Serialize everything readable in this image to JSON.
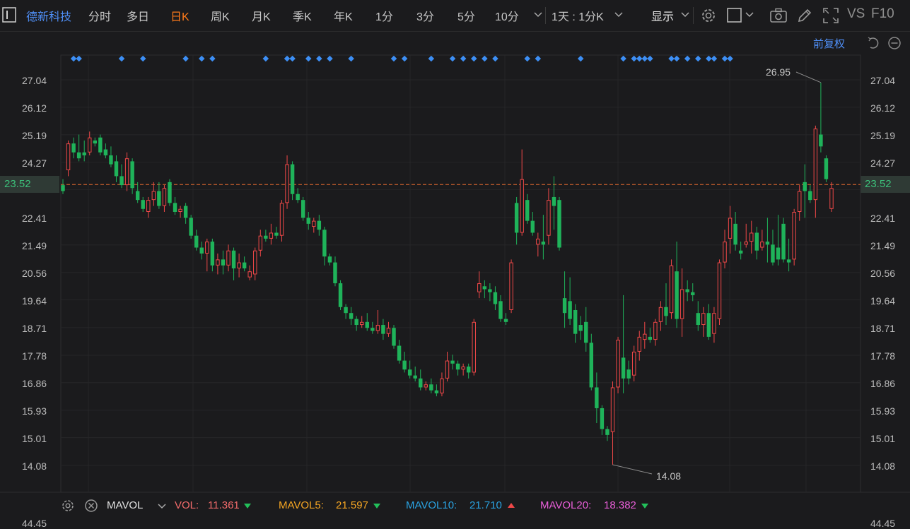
{
  "toolbar": {
    "stock_name": "德新科技",
    "periods": [
      "分时",
      "多日",
      "日K",
      "周K",
      "月K",
      "季K",
      "年K",
      "1分",
      "3分",
      "5分",
      "10分"
    ],
    "active_period": "日K",
    "range_label": "1天 : 1分K",
    "display_label": "显示",
    "vs_label": "VS",
    "f10_label": "F10",
    "adjust_label": "前复权"
  },
  "price_axis": {
    "ticks": [
      "27.04",
      "26.12",
      "25.19",
      "24.27",
      "23.52",
      "22.41",
      "21.49",
      "20.56",
      "19.64",
      "18.71",
      "17.78",
      "16.86",
      "15.93",
      "15.01",
      "14.08"
    ],
    "current": "23.52",
    "bottom_partial": "44.45"
  },
  "colors": {
    "up": "#f04848",
    "down": "#1fb35a",
    "current_line": "#e36a2e",
    "marker": "#3d8ff5"
  },
  "indicator_bar": {
    "name": "MAVOL",
    "vol_label": "VOL:",
    "vol_value": "11.361",
    "vol_color": "#f36b6b",
    "ma5_label": "MAVOL5:",
    "ma5_value": "21.597",
    "ma5_color": "#f6a623",
    "ma10_label": "MAVOL10:",
    "ma10_value": "21.710",
    "ma10_color": "#2aa3e2",
    "ma20_label": "MAVOL20:",
    "ma20_value": "18.382",
    "ma20_color": "#e85ed8"
  },
  "chart_data": {
    "type": "candlestick",
    "title": "",
    "y_range": [
      13.0,
      28.0
    ],
    "current_price": 23.52,
    "max_label": "26.95",
    "min_label": "14.08",
    "event_marker_index": [
      2,
      3,
      11,
      15,
      23,
      26,
      28,
      38,
      42,
      43,
      46,
      48,
      50,
      54,
      62,
      64,
      69,
      73,
      75,
      77,
      79,
      81,
      87,
      89,
      97,
      105,
      107,
      108,
      109,
      110,
      114,
      115,
      117,
      119,
      121,
      122,
      124,
      125
    ],
    "candles": [
      {
        "o": 23.5,
        "h": 23.7,
        "l": 23.2,
        "c": 23.3
      },
      {
        "o": 24.0,
        "h": 25.0,
        "l": 23.8,
        "c": 24.9
      },
      {
        "o": 24.9,
        "h": 25.1,
        "l": 24.4,
        "c": 24.6
      },
      {
        "o": 24.6,
        "h": 25.2,
        "l": 24.3,
        "c": 24.4
      },
      {
        "o": 24.6,
        "h": 25.0,
        "l": 24.3,
        "c": 24.5
      },
      {
        "o": 24.6,
        "h": 25.3,
        "l": 24.5,
        "c": 25.1
      },
      {
        "o": 25.0,
        "h": 25.1,
        "l": 24.8,
        "c": 24.9
      },
      {
        "o": 25.1,
        "h": 25.2,
        "l": 24.5,
        "c": 24.6
      },
      {
        "o": 24.7,
        "h": 24.9,
        "l": 24.4,
        "c": 24.5
      },
      {
        "o": 24.5,
        "h": 24.8,
        "l": 24.1,
        "c": 24.2
      },
      {
        "o": 24.3,
        "h": 24.5,
        "l": 23.6,
        "c": 23.8
      },
      {
        "o": 23.8,
        "h": 24.2,
        "l": 23.4,
        "c": 23.5
      },
      {
        "o": 23.5,
        "h": 24.6,
        "l": 23.3,
        "c": 24.4
      },
      {
        "o": 24.3,
        "h": 24.4,
        "l": 23.2,
        "c": 23.4
      },
      {
        "o": 23.3,
        "h": 23.6,
        "l": 22.9,
        "c": 23.0
      },
      {
        "o": 23.0,
        "h": 23.1,
        "l": 22.6,
        "c": 22.7
      },
      {
        "o": 22.6,
        "h": 23.1,
        "l": 22.4,
        "c": 23.0
      },
      {
        "o": 23.0,
        "h": 23.6,
        "l": 22.8,
        "c": 23.3
      },
      {
        "o": 23.3,
        "h": 23.6,
        "l": 22.7,
        "c": 22.8
      },
      {
        "o": 22.8,
        "h": 23.5,
        "l": 22.6,
        "c": 23.4
      },
      {
        "o": 23.6,
        "h": 23.7,
        "l": 22.8,
        "c": 22.9
      },
      {
        "o": 22.9,
        "h": 23.1,
        "l": 22.5,
        "c": 22.6
      },
      {
        "o": 22.6,
        "h": 22.8,
        "l": 22.4,
        "c": 22.7
      },
      {
        "o": 22.8,
        "h": 22.9,
        "l": 22.2,
        "c": 22.4
      },
      {
        "o": 22.4,
        "h": 22.5,
        "l": 21.7,
        "c": 21.8
      },
      {
        "o": 21.8,
        "h": 22.0,
        "l": 21.3,
        "c": 21.4
      },
      {
        "o": 21.4,
        "h": 21.6,
        "l": 21.0,
        "c": 21.2
      },
      {
        "o": 21.2,
        "h": 21.7,
        "l": 20.6,
        "c": 21.6
      },
      {
        "o": 21.6,
        "h": 21.7,
        "l": 20.6,
        "c": 20.8
      },
      {
        "o": 20.8,
        "h": 21.2,
        "l": 20.5,
        "c": 21.0
      },
      {
        "o": 21.0,
        "h": 21.3,
        "l": 20.5,
        "c": 20.8
      },
      {
        "o": 20.8,
        "h": 21.5,
        "l": 20.6,
        "c": 21.3
      },
      {
        "o": 21.3,
        "h": 21.4,
        "l": 20.3,
        "c": 20.7
      },
      {
        "o": 20.7,
        "h": 21.2,
        "l": 20.4,
        "c": 20.9
      },
      {
        "o": 20.9,
        "h": 21.1,
        "l": 20.6,
        "c": 20.7
      },
      {
        "o": 20.4,
        "h": 20.8,
        "l": 20.3,
        "c": 20.6
      },
      {
        "o": 20.5,
        "h": 21.4,
        "l": 20.3,
        "c": 21.3
      },
      {
        "o": 21.3,
        "h": 22.0,
        "l": 21.1,
        "c": 21.8
      },
      {
        "o": 21.8,
        "h": 22.0,
        "l": 21.6,
        "c": 21.7
      },
      {
        "o": 21.7,
        "h": 22.2,
        "l": 21.5,
        "c": 21.9
      },
      {
        "o": 21.9,
        "h": 22.1,
        "l": 21.7,
        "c": 21.8
      },
      {
        "o": 21.8,
        "h": 23.0,
        "l": 21.6,
        "c": 22.9
      },
      {
        "o": 22.9,
        "h": 24.5,
        "l": 22.7,
        "c": 24.2
      },
      {
        "o": 24.2,
        "h": 24.3,
        "l": 23.0,
        "c": 23.2
      },
      {
        "o": 23.2,
        "h": 23.4,
        "l": 22.9,
        "c": 23.0
      },
      {
        "o": 23.0,
        "h": 23.1,
        "l": 22.3,
        "c": 22.4
      },
      {
        "o": 22.4,
        "h": 22.6,
        "l": 22.0,
        "c": 22.2
      },
      {
        "o": 22.1,
        "h": 22.4,
        "l": 21.9,
        "c": 22.3
      },
      {
        "o": 22.3,
        "h": 22.5,
        "l": 21.8,
        "c": 22.0
      },
      {
        "o": 22.0,
        "h": 22.1,
        "l": 20.8,
        "c": 21.1
      },
      {
        "o": 21.1,
        "h": 21.2,
        "l": 20.8,
        "c": 20.9
      },
      {
        "o": 20.9,
        "h": 21.1,
        "l": 20.1,
        "c": 20.2
      },
      {
        "o": 20.2,
        "h": 20.3,
        "l": 19.3,
        "c": 19.4
      },
      {
        "o": 19.4,
        "h": 19.5,
        "l": 19.0,
        "c": 19.2
      },
      {
        "o": 19.2,
        "h": 19.4,
        "l": 18.8,
        "c": 19.0
      },
      {
        "o": 19.0,
        "h": 19.1,
        "l": 18.6,
        "c": 18.8
      },
      {
        "o": 18.8,
        "h": 19.1,
        "l": 18.7,
        "c": 18.9
      },
      {
        "o": 18.9,
        "h": 19.2,
        "l": 18.6,
        "c": 18.7
      },
      {
        "o": 18.7,
        "h": 18.9,
        "l": 18.5,
        "c": 18.6
      },
      {
        "o": 18.6,
        "h": 19.3,
        "l": 18.5,
        "c": 18.8
      },
      {
        "o": 18.8,
        "h": 19.0,
        "l": 18.3,
        "c": 18.5
      },
      {
        "o": 18.5,
        "h": 18.9,
        "l": 18.4,
        "c": 18.7
      },
      {
        "o": 18.7,
        "h": 18.8,
        "l": 18.0,
        "c": 18.1
      },
      {
        "o": 18.1,
        "h": 18.3,
        "l": 17.5,
        "c": 17.6
      },
      {
        "o": 17.6,
        "h": 17.9,
        "l": 17.2,
        "c": 17.3
      },
      {
        "o": 17.3,
        "h": 17.6,
        "l": 17.0,
        "c": 17.1
      },
      {
        "o": 17.1,
        "h": 17.4,
        "l": 16.9,
        "c": 17.0
      },
      {
        "o": 17.0,
        "h": 17.3,
        "l": 16.6,
        "c": 16.7
      },
      {
        "o": 16.7,
        "h": 16.9,
        "l": 16.6,
        "c": 16.8
      },
      {
        "o": 16.8,
        "h": 17.0,
        "l": 16.5,
        "c": 16.6
      },
      {
        "o": 16.6,
        "h": 16.8,
        "l": 16.4,
        "c": 16.5
      },
      {
        "o": 16.5,
        "h": 17.2,
        "l": 16.4,
        "c": 17.0
      },
      {
        "o": 17.0,
        "h": 17.9,
        "l": 16.9,
        "c": 17.6
      },
      {
        "o": 17.6,
        "h": 17.8,
        "l": 17.3,
        "c": 17.5
      },
      {
        "o": 17.5,
        "h": 17.6,
        "l": 17.1,
        "c": 17.3
      },
      {
        "o": 17.3,
        "h": 17.5,
        "l": 17.1,
        "c": 17.4
      },
      {
        "o": 17.4,
        "h": 17.5,
        "l": 17.0,
        "c": 17.2
      },
      {
        "o": 17.2,
        "h": 19.0,
        "l": 17.1,
        "c": 18.9
      },
      {
        "o": 19.9,
        "h": 20.6,
        "l": 19.7,
        "c": 20.2
      },
      {
        "o": 20.1,
        "h": 20.3,
        "l": 19.7,
        "c": 20.0
      },
      {
        "o": 20.0,
        "h": 20.2,
        "l": 19.6,
        "c": 19.9
      },
      {
        "o": 19.9,
        "h": 20.1,
        "l": 19.3,
        "c": 19.5
      },
      {
        "o": 19.6,
        "h": 19.8,
        "l": 18.9,
        "c": 19.0
      },
      {
        "o": 19.0,
        "h": 19.2,
        "l": 18.8,
        "c": 18.9
      },
      {
        "o": 19.3,
        "h": 21.0,
        "l": 19.2,
        "c": 20.9
      },
      {
        "o": 22.9,
        "h": 23.1,
        "l": 21.5,
        "c": 21.9
      },
      {
        "o": 21.9,
        "h": 24.7,
        "l": 21.8,
        "c": 23.7
      },
      {
        "o": 23.0,
        "h": 23.2,
        "l": 22.2,
        "c": 22.3
      },
      {
        "o": 22.3,
        "h": 22.6,
        "l": 21.8,
        "c": 21.9
      },
      {
        "o": 21.5,
        "h": 21.9,
        "l": 21.1,
        "c": 21.7
      },
      {
        "o": 21.6,
        "h": 22.5,
        "l": 21.0,
        "c": 21.5
      },
      {
        "o": 21.8,
        "h": 23.4,
        "l": 21.5,
        "c": 23.0
      },
      {
        "o": 23.1,
        "h": 23.8,
        "l": 22.0,
        "c": 22.8
      },
      {
        "o": 23.0,
        "h": 23.1,
        "l": 21.3,
        "c": 21.4
      },
      {
        "o": 19.7,
        "h": 20.6,
        "l": 18.7,
        "c": 19.2
      },
      {
        "o": 19.6,
        "h": 20.4,
        "l": 18.8,
        "c": 19.0
      },
      {
        "o": 19.3,
        "h": 19.5,
        "l": 18.2,
        "c": 18.5
      },
      {
        "o": 18.8,
        "h": 19.1,
        "l": 18.3,
        "c": 18.6
      },
      {
        "o": 18.9,
        "h": 19.4,
        "l": 17.9,
        "c": 18.2
      },
      {
        "o": 18.2,
        "h": 18.5,
        "l": 16.6,
        "c": 16.7
      },
      {
        "o": 16.7,
        "h": 17.2,
        "l": 15.5,
        "c": 16.0
      },
      {
        "o": 16.0,
        "h": 16.1,
        "l": 15.1,
        "c": 15.3
      },
      {
        "o": 15.3,
        "h": 15.4,
        "l": 14.9,
        "c": 15.1
      },
      {
        "o": 15.2,
        "h": 16.9,
        "l": 14.1,
        "c": 16.7
      },
      {
        "o": 16.7,
        "h": 18.4,
        "l": 16.5,
        "c": 18.3
      },
      {
        "o": 17.7,
        "h": 19.8,
        "l": 16.5,
        "c": 17.0
      },
      {
        "o": 17.3,
        "h": 17.6,
        "l": 16.8,
        "c": 17.0
      },
      {
        "o": 17.1,
        "h": 18.1,
        "l": 16.9,
        "c": 17.9
      },
      {
        "o": 17.9,
        "h": 18.6,
        "l": 17.6,
        "c": 18.4
      },
      {
        "o": 18.3,
        "h": 18.9,
        "l": 18.0,
        "c": 18.5
      },
      {
        "o": 18.4,
        "h": 18.7,
        "l": 18.2,
        "c": 18.3
      },
      {
        "o": 18.3,
        "h": 19.0,
        "l": 18.1,
        "c": 18.9
      },
      {
        "o": 18.9,
        "h": 19.6,
        "l": 18.6,
        "c": 19.4
      },
      {
        "o": 19.4,
        "h": 20.2,
        "l": 18.8,
        "c": 19.1
      },
      {
        "o": 19.2,
        "h": 21.0,
        "l": 19.0,
        "c": 20.8
      },
      {
        "o": 20.6,
        "h": 21.6,
        "l": 18.7,
        "c": 19.0
      },
      {
        "o": 19.0,
        "h": 20.7,
        "l": 18.4,
        "c": 20.0
      },
      {
        "o": 20.0,
        "h": 20.3,
        "l": 19.6,
        "c": 19.9
      },
      {
        "o": 19.9,
        "h": 20.2,
        "l": 19.6,
        "c": 19.8
      },
      {
        "o": 19.2,
        "h": 19.6,
        "l": 18.6,
        "c": 18.8
      },
      {
        "o": 18.8,
        "h": 19.4,
        "l": 18.4,
        "c": 19.2
      },
      {
        "o": 19.2,
        "h": 19.5,
        "l": 18.3,
        "c": 18.4
      },
      {
        "o": 18.5,
        "h": 19.4,
        "l": 18.2,
        "c": 19.2
      },
      {
        "o": 19.0,
        "h": 21.0,
        "l": 18.8,
        "c": 20.9
      },
      {
        "o": 20.9,
        "h": 22.0,
        "l": 20.7,
        "c": 21.6
      },
      {
        "o": 21.7,
        "h": 22.8,
        "l": 21.2,
        "c": 22.4
      },
      {
        "o": 22.2,
        "h": 22.6,
        "l": 21.3,
        "c": 21.5
      },
      {
        "o": 21.3,
        "h": 21.6,
        "l": 21.0,
        "c": 21.2
      },
      {
        "o": 21.5,
        "h": 22.2,
        "l": 21.4,
        "c": 21.6
      },
      {
        "o": 21.6,
        "h": 22.3,
        "l": 21.2,
        "c": 21.9
      },
      {
        "o": 21.9,
        "h": 22.1,
        "l": 21.0,
        "c": 21.3
      },
      {
        "o": 21.4,
        "h": 22.0,
        "l": 21.3,
        "c": 21.6
      },
      {
        "o": 21.6,
        "h": 22.4,
        "l": 20.9,
        "c": 21.5
      },
      {
        "o": 21.5,
        "h": 22.0,
        "l": 20.8,
        "c": 20.9
      },
      {
        "o": 21.4,
        "h": 22.5,
        "l": 20.8,
        "c": 21.0
      },
      {
        "o": 22.2,
        "h": 22.4,
        "l": 20.9,
        "c": 21.0
      },
      {
        "o": 21.0,
        "h": 21.7,
        "l": 20.6,
        "c": 20.9
      },
      {
        "o": 21.0,
        "h": 22.7,
        "l": 20.8,
        "c": 22.6
      },
      {
        "o": 22.6,
        "h": 23.5,
        "l": 22.3,
        "c": 23.3
      },
      {
        "o": 23.6,
        "h": 24.2,
        "l": 22.4,
        "c": 23.3
      },
      {
        "o": 23.3,
        "h": 23.5,
        "l": 22.9,
        "c": 23.0
      },
      {
        "o": 23.0,
        "h": 25.5,
        "l": 22.4,
        "c": 25.4
      },
      {
        "o": 25.2,
        "h": 26.95,
        "l": 24.6,
        "c": 24.8
      },
      {
        "o": 24.4,
        "h": 24.5,
        "l": 23.6,
        "c": 23.7
      },
      {
        "o": 22.7,
        "h": 23.6,
        "l": 22.6,
        "c": 23.4
      }
    ]
  }
}
